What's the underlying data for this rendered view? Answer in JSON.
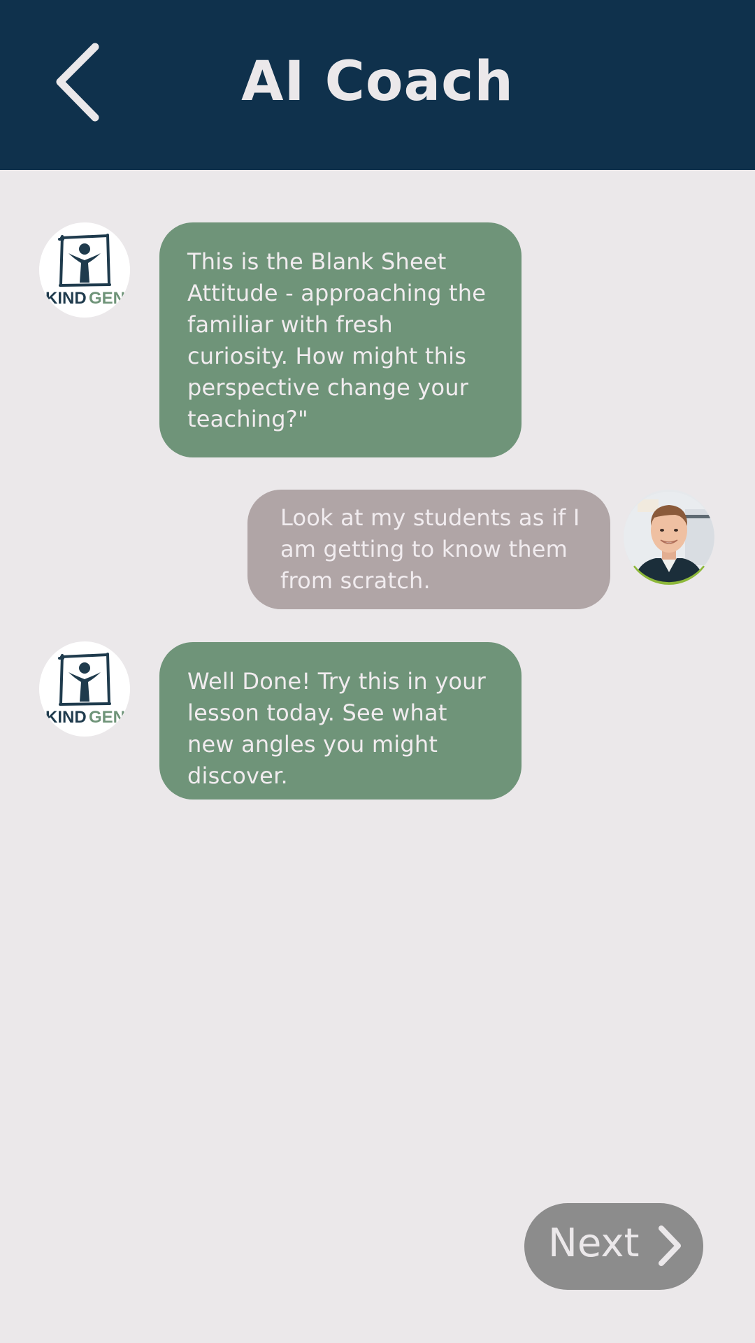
{
  "header": {
    "title": "AI Coach",
    "back_icon": "chevron-left-icon",
    "background_color": "#0f314c"
  },
  "bot": {
    "logo_text_left": "KIND",
    "logo_text_right": "GEN"
  },
  "messages": [
    {
      "sender": "bot",
      "text": "This is the Blank Sheet Attitude - approaching the familiar with fresh curiosity. How might this perspective change your teaching?\"",
      "bubble_color": "#6f9479"
    },
    {
      "sender": "user",
      "text": "Look at my students as if I am getting to know them from scratch.",
      "bubble_color": "#b0a5a6"
    },
    {
      "sender": "bot",
      "text": "Well Done! Try this in your lesson today. See what new angles you might discover.",
      "bubble_color": "#6f9479"
    }
  ],
  "next_button": {
    "label": "Next",
    "icon": "chevron-right-icon",
    "color": "#8c8c8c"
  }
}
